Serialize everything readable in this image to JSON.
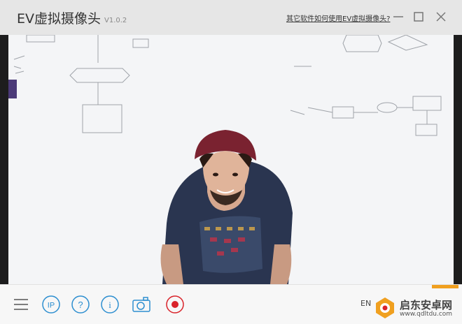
{
  "window": {
    "title": "EV虚拟摄像头",
    "version": "V1.0.2",
    "help_link": "其它软件如何使用EV虚拟摄像头?"
  },
  "colors": {
    "titlebar": "#e6e6e6",
    "toolbar_icon": "#2e8fd0",
    "record_red": "#d9232a",
    "accent": "#f0a020"
  },
  "preview": {
    "description_icon": "webcam-preview"
  },
  "toolbar": {
    "lang_label": "EN",
    "icons": [
      "menu-icon",
      "ip-icon",
      "help-icon",
      "info-icon",
      "camera-icon",
      "record-icon"
    ]
  },
  "watermark": {
    "name": "启东安卓网",
    "url": "www.qdltdu.com"
  }
}
